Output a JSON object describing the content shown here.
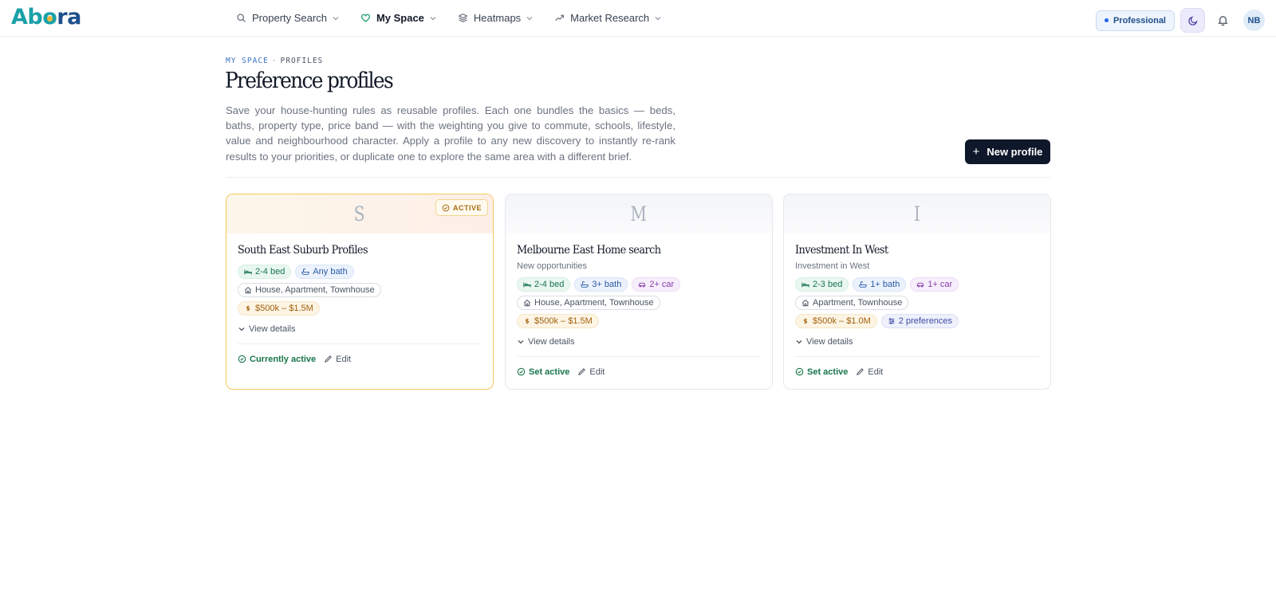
{
  "brand": {
    "logo_part1": "Ab",
    "logo_part2": "o",
    "logo_part3": "ra"
  },
  "nav": {
    "items": [
      {
        "label": "Property Search",
        "icon": "search-icon"
      },
      {
        "label": "My Space",
        "icon": "heart-icon",
        "active": true
      },
      {
        "label": "Heatmaps",
        "icon": "layers-icon"
      },
      {
        "label": "Market Research",
        "icon": "trending-up-icon"
      }
    ]
  },
  "header": {
    "plan_label": "Professional",
    "avatar_initials": "NB"
  },
  "breadcrumb": {
    "part1": "MY SPACE",
    "separator": "·",
    "part2": "PROFILES"
  },
  "page": {
    "title": "Preference profiles",
    "description": "Save your house-hunting rules as reusable profiles. Each one bundles the basics — beds, baths, property type, price band — with the weighting you give to commute, schools, lifestyle, value and neighbourhood character. Apply a profile to any new discovery to instantly re-rank results to your priorities, or duplicate one to explore the same area with a different brief.",
    "new_button_label": "New profile"
  },
  "profiles": [
    {
      "initial": "S",
      "active_badge": "ACTIVE",
      "name": "South East Suburb Profiles",
      "subtitle": "",
      "bed": "2-4 bed",
      "bath": "Any bath",
      "car": "",
      "types": "House, Apartment, Townhouse",
      "price": "$500k – $1.5M",
      "preferences": "",
      "details_label": "View details",
      "status_label": "Currently active",
      "edit_label": "Edit"
    },
    {
      "initial": "M",
      "name": "Melbourne East Home search",
      "subtitle": "New opportunities",
      "bed": "2-4 bed",
      "bath": "3+ bath",
      "car": "2+ car",
      "types": "House, Apartment, Townhouse",
      "price": "$500k – $1.5M",
      "details_label": "View details",
      "status_label": "Set active",
      "edit_label": "Edit"
    },
    {
      "initial": "I",
      "name": "Investment In West",
      "subtitle": "Investment in West",
      "bed": "2-3 bed",
      "bath": "1+ bath",
      "car": "1+ car",
      "types": "Apartment, Townhouse",
      "price": "$500k – $1.0M",
      "preferences": "2 preferences",
      "details_label": "View details",
      "status_label": "Set active",
      "edit_label": "Edit"
    }
  ]
}
